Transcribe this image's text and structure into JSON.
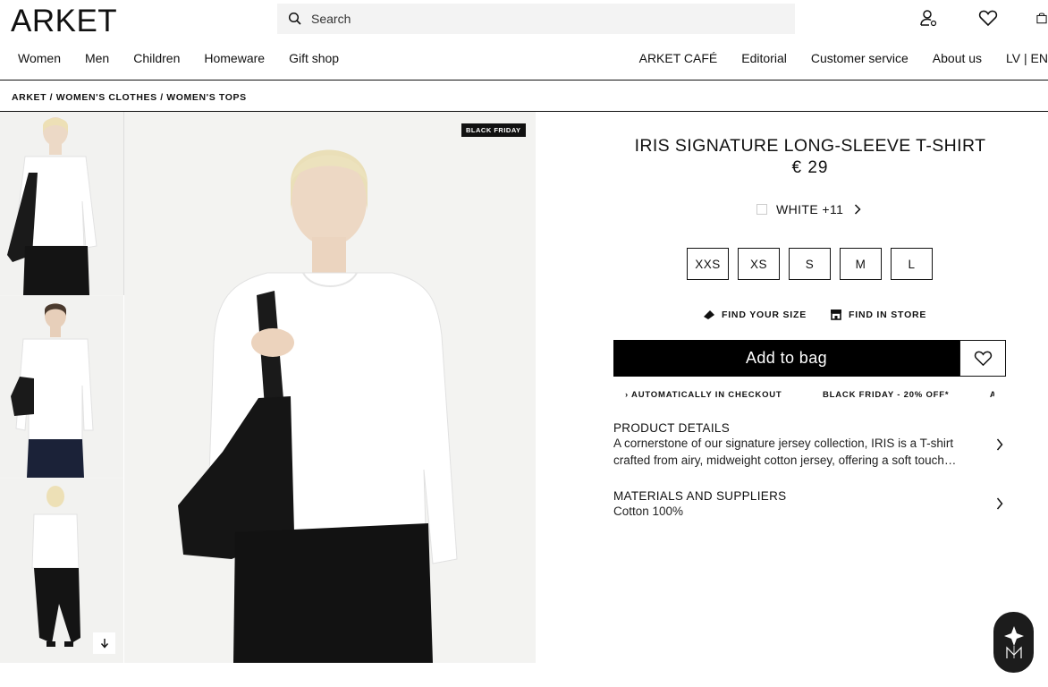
{
  "header": {
    "logo": "ARKET",
    "search_placeholder": "Search",
    "icons": [
      "account-icon",
      "wishlist-icon",
      "bag-icon"
    ]
  },
  "nav": {
    "left": [
      "Women",
      "Men",
      "Children",
      "Homeware",
      "Gift shop"
    ],
    "right": [
      "ARKET CAFÉ",
      "Editorial",
      "Customer service",
      "About us",
      "LV | EN"
    ]
  },
  "breadcrumb": "ARKET / WOMEN'S CLOTHES / WOMEN'S TOPS",
  "gallery": {
    "badge": "BLACK FRIDAY",
    "thumbnail_count": 3
  },
  "product": {
    "title": "IRIS SIGNATURE LONG-SLEEVE T-SHIRT",
    "price": "€ 29",
    "color_label": "WHITE +11",
    "sizes": [
      "XXS",
      "XS",
      "S",
      "M",
      "L"
    ],
    "find_size": "FIND YOUR SIZE",
    "find_store": "FIND IN STORE",
    "add_to_bag": "Add to bag"
  },
  "ticker": {
    "items": [
      "› AUTOMATICALLY IN CHECKOUT",
      "BLACK FRIDAY - 20% OFF*",
      "A"
    ]
  },
  "details": {
    "title": "PRODUCT DETAILS",
    "body": "A cornerstone of our signature jersey collection, IRIS is a T-shirt crafted from airy, midweight cotton jersey, offering a soft touch…"
  },
  "materials": {
    "title": "MATERIALS AND SUPPLIERS",
    "body": "Cotton 100%"
  },
  "colors": {
    "text": "#111111",
    "background": "#ffffff",
    "button": "#000000",
    "image_bg": "#f3f3f1"
  }
}
